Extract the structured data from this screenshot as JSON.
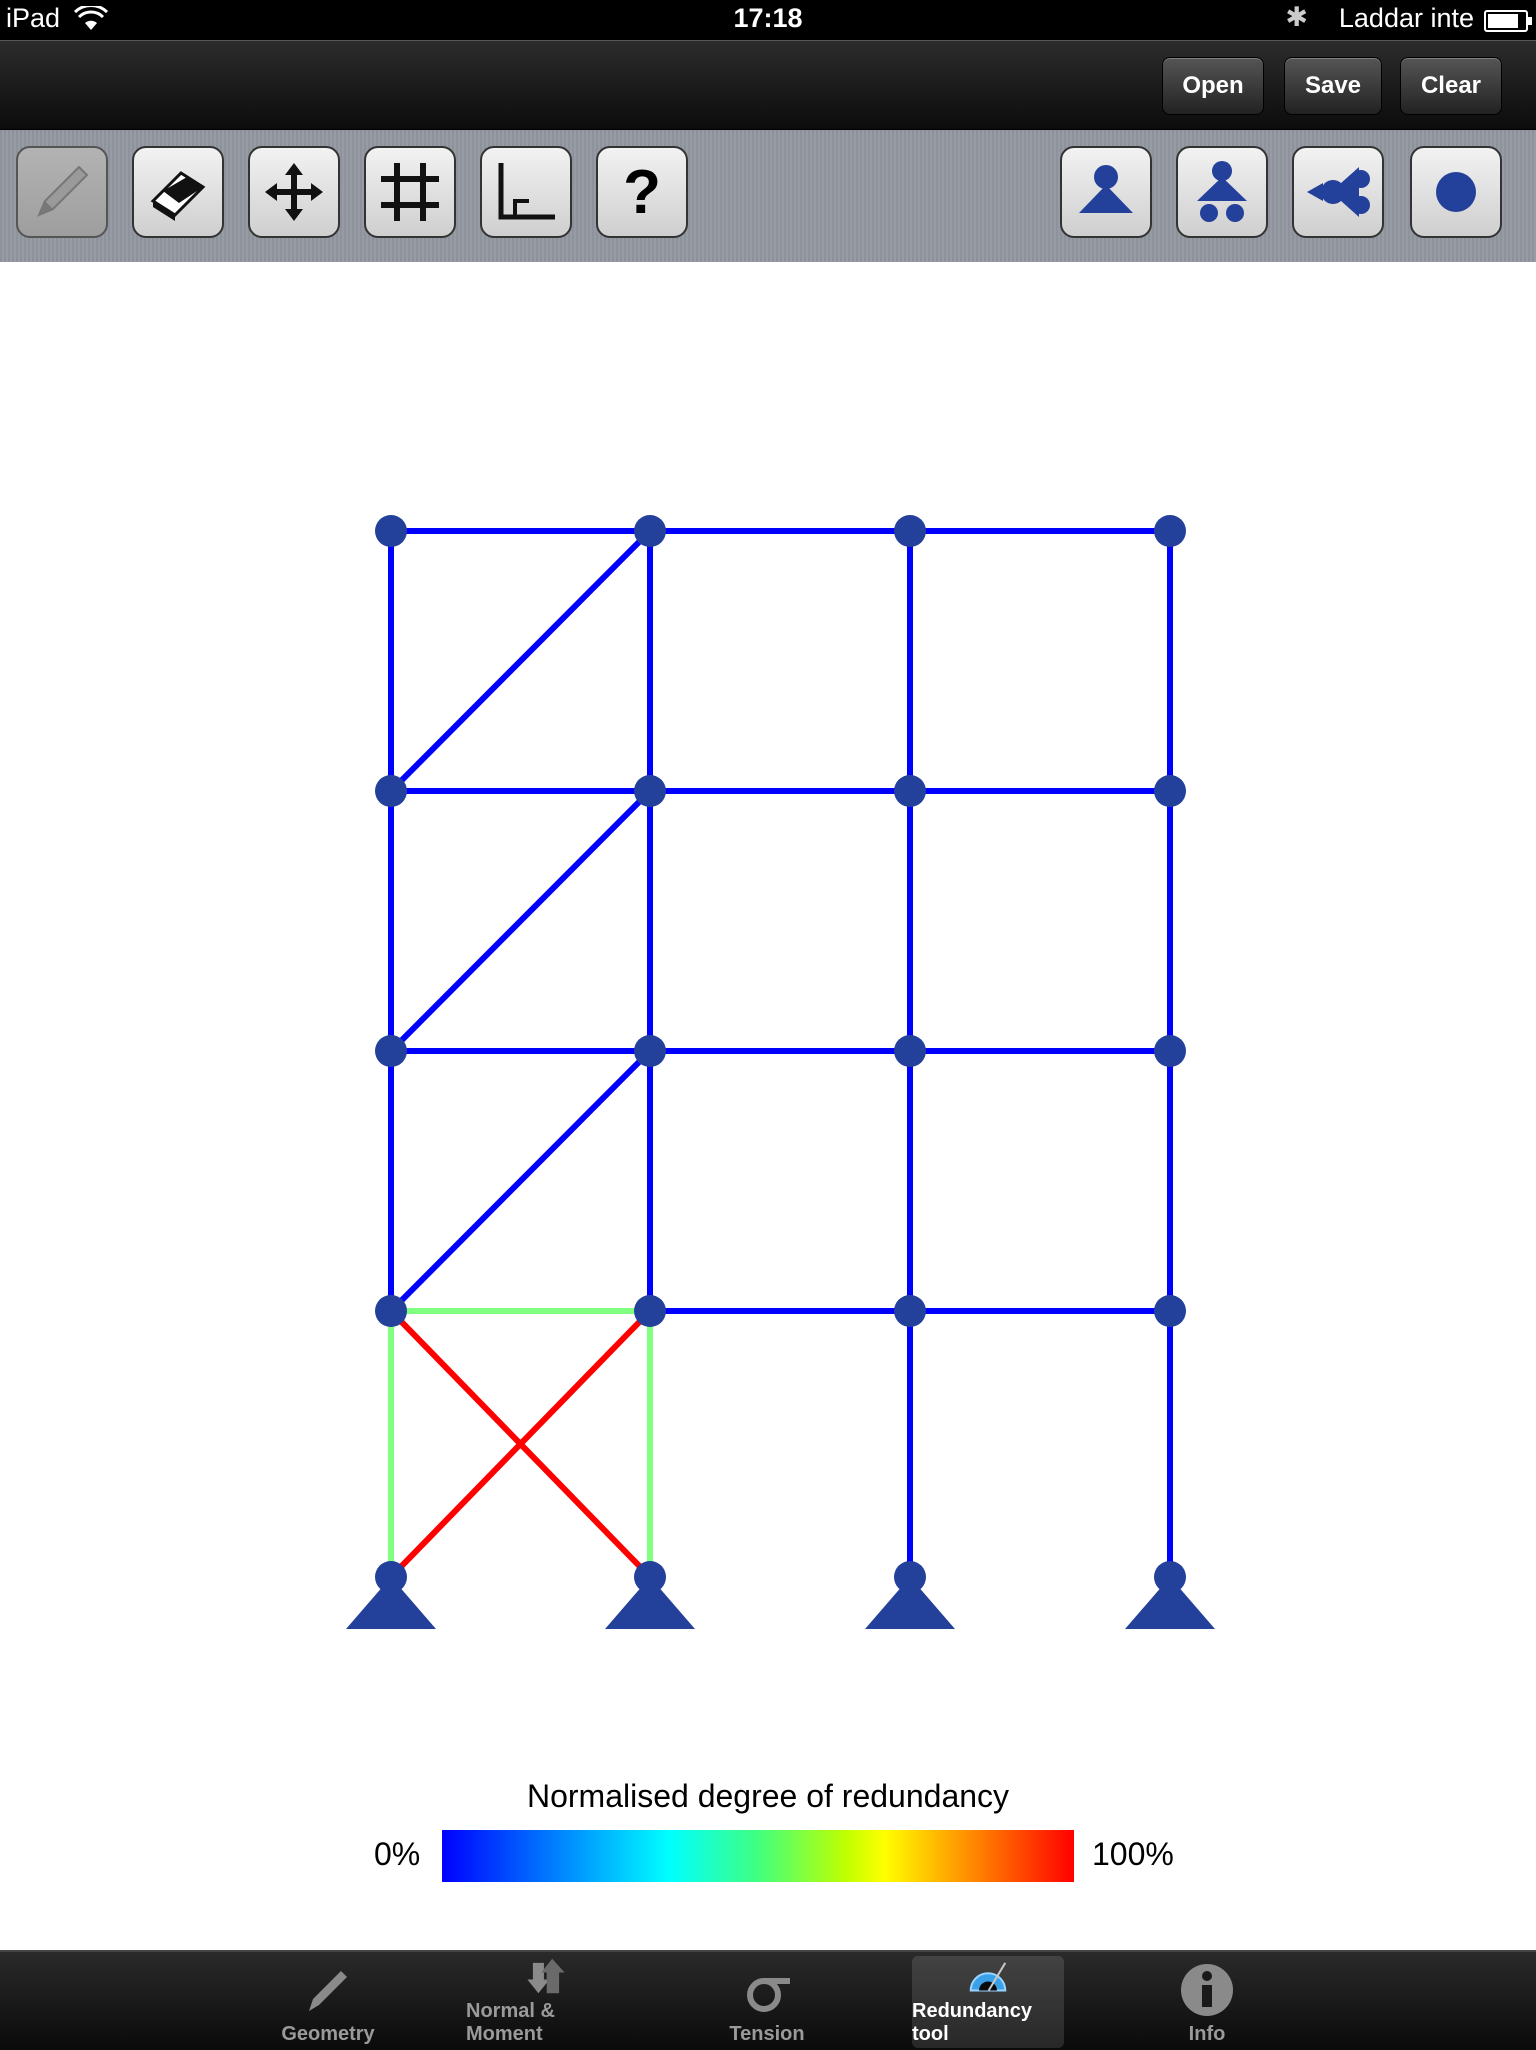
{
  "status": {
    "device": "iPad",
    "time": "17:18",
    "battery_text": "Laddar inte"
  },
  "nav": {
    "open": "Open",
    "save": "Save",
    "clear": "Clear"
  },
  "toolbar": {
    "left_tools": [
      "pencil-icon",
      "eraser-icon",
      "move-arrows-icon",
      "grid-icon",
      "angle-icon",
      "help-icon"
    ],
    "right_tools": [
      "fixed-support-icon",
      "roller-support-icon",
      "hinge-icon",
      "node-icon"
    ],
    "help_label": "?"
  },
  "legend": {
    "title": "Normalised degree of redundancy",
    "min": "0%",
    "max": "100%",
    "colors": [
      "#0000ff",
      "#00ffff",
      "#ffff00",
      "#ff0000"
    ]
  },
  "colors": {
    "member_blue": "#0000ff",
    "member_green": "#80ff80",
    "member_red": "#ff0000",
    "node": "#23409a"
  },
  "tabs": [
    {
      "label": "Geometry",
      "icon": "pencil-icon"
    },
    {
      "label": "Normal & Moment",
      "icon": "arrows-icon"
    },
    {
      "label": "Tension",
      "icon": "sigma-icon"
    },
    {
      "label": "Redundancy tool",
      "icon": "protractor-icon",
      "active": true
    },
    {
      "label": "Info",
      "icon": "info-icon"
    }
  ]
}
